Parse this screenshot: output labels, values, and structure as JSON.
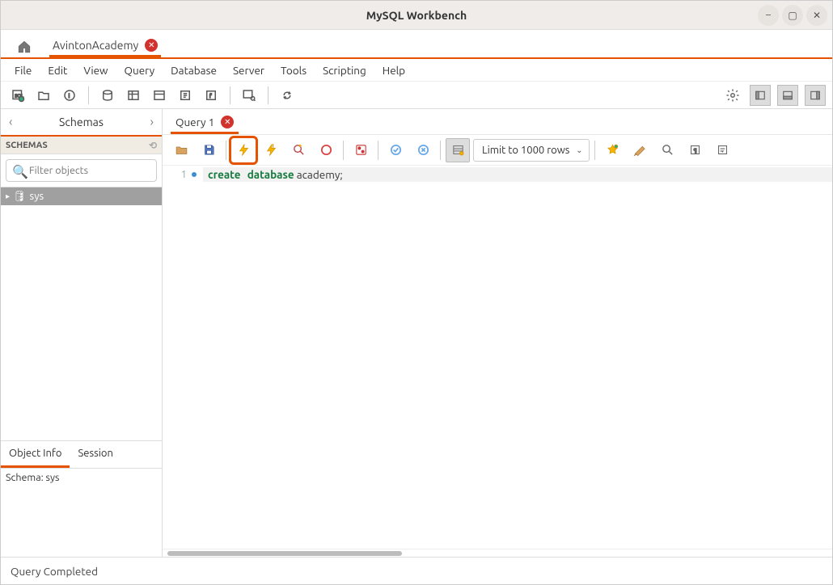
{
  "window": {
    "title": "MySQL Workbench"
  },
  "connection_tabs": {
    "active_label": "AvintonAcademy"
  },
  "menu": {
    "file": "File",
    "edit": "Edit",
    "view": "View",
    "query": "Query",
    "database": "Database",
    "server": "Server",
    "tools": "Tools",
    "scripting": "Scripting",
    "help": "Help"
  },
  "sidebar": {
    "header": "Schemas",
    "panel_label": "SCHEMAS",
    "filter_placeholder": "Filter objects",
    "tree_item": "sys",
    "info_tabs": {
      "object": "Object Info",
      "session": "Session"
    },
    "info_text": "Schema: sys"
  },
  "query": {
    "tab_label": "Query 1",
    "limit_label": "Limit to 1000 rows",
    "line_number": "1",
    "kw_create": "create",
    "kw_database": "database",
    "code_rest": " academy;"
  },
  "status": {
    "text": "Query Completed"
  }
}
